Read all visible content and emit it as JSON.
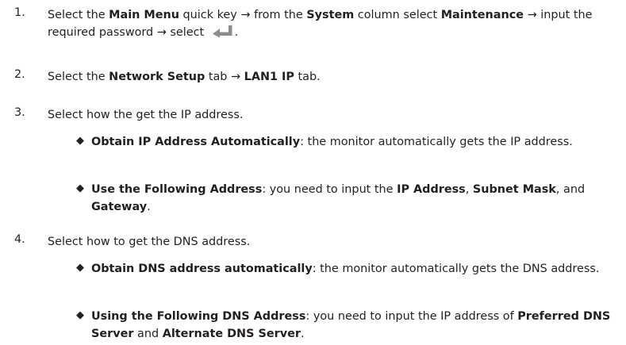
{
  "steps": [
    {
      "number": "1.",
      "parts": [
        [
          "t",
          "Select the "
        ],
        [
          "b",
          "Main Menu"
        ],
        [
          "t",
          " quick key → from the "
        ],
        [
          "b",
          "System"
        ],
        [
          "t",
          " column select "
        ],
        [
          "b",
          "Maintenance"
        ],
        [
          "t",
          " → input the required password → select "
        ],
        [
          "icon",
          "enter-icon"
        ],
        [
          "t",
          "."
        ]
      ]
    },
    {
      "number": "2.",
      "parts": [
        [
          "t",
          "Select the "
        ],
        [
          "b",
          "Network Setup"
        ],
        [
          "t",
          " tab → "
        ],
        [
          "b",
          "LAN1 IP"
        ],
        [
          "t",
          " tab."
        ]
      ]
    },
    {
      "number": "3.",
      "parts": [
        [
          "t",
          "Select how the get the IP address."
        ]
      ]
    },
    {
      "number": "4.",
      "parts": [
        [
          "t",
          "Select how to get the DNS address."
        ]
      ]
    }
  ],
  "bullets": [
    {
      "symbol": "◆",
      "parts": [
        [
          "b",
          "Obtain IP Address Automatically"
        ],
        [
          "t",
          ": the monitor automatically gets the IP address."
        ]
      ]
    },
    {
      "symbol": "◆",
      "parts": [
        [
          "b",
          "Use the Following Address"
        ],
        [
          "t",
          ": you need to input the "
        ],
        [
          "b",
          "IP Address"
        ],
        [
          "t",
          ", "
        ],
        [
          "b",
          "Subnet Mask"
        ],
        [
          "t",
          ", and "
        ],
        [
          "b",
          "Gateway"
        ],
        [
          "t",
          "."
        ]
      ]
    },
    {
      "symbol": "◆",
      "parts": [
        [
          "b",
          "Obtain DNS address automatically"
        ],
        [
          "t",
          ": the monitor automatically gets the DNS address."
        ]
      ]
    },
    {
      "symbol": "◆",
      "parts": [
        [
          "b",
          "Using the Following DNS Address"
        ],
        [
          "t",
          ": you need to input the IP address of "
        ],
        [
          "b",
          "Preferred DNS Server"
        ],
        [
          "t",
          " and "
        ],
        [
          "b",
          "Alternate DNS Server"
        ],
        [
          "t",
          "."
        ]
      ]
    }
  ],
  "colors": {
    "text": "#231f20",
    "icon": "#8c8c8c"
  }
}
